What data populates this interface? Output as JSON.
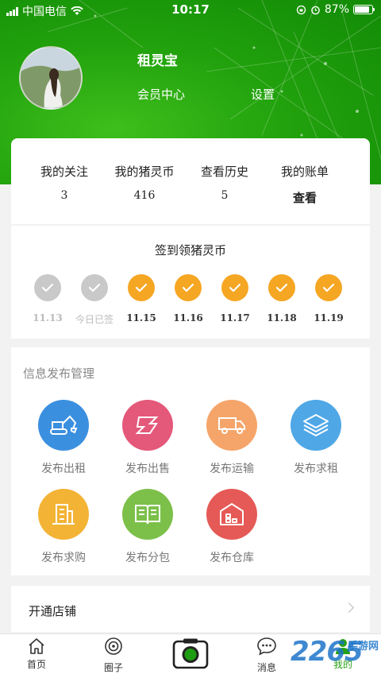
{
  "status_bar": {
    "carrier": "中国电信",
    "time": "10:17",
    "battery": "87%",
    "battery_level": 0.87
  },
  "profile": {
    "name": "租灵宝",
    "member_center": "会员中心",
    "settings": "设置"
  },
  "stats": [
    {
      "label": "我的关注",
      "value": "3"
    },
    {
      "label": "我的猪灵币",
      "value": "416"
    },
    {
      "label": "查看历史",
      "value": "5"
    },
    {
      "label": "我的账单",
      "value": "查看"
    }
  ],
  "checkin": {
    "title": "签到领猪灵币",
    "days": [
      {
        "label": "11.13",
        "state": "done"
      },
      {
        "label": "今日已签",
        "state": "today"
      },
      {
        "label": "11.15",
        "state": "future"
      },
      {
        "label": "11.16",
        "state": "future"
      },
      {
        "label": "11.17",
        "state": "future"
      },
      {
        "label": "11.18",
        "state": "future"
      },
      {
        "label": "11.19",
        "state": "future"
      }
    ]
  },
  "publish": {
    "title": "信息发布管理",
    "items": [
      {
        "label": "发布出租",
        "icon": "excavator-icon",
        "color": "#3b8fdf"
      },
      {
        "label": "发布出售",
        "icon": "steel-beam-icon",
        "color": "#e4587a"
      },
      {
        "label": "发布运输",
        "icon": "truck-icon",
        "color": "#f5a56a"
      },
      {
        "label": "发布求租",
        "icon": "layers-icon",
        "color": "#4fa7e6"
      },
      {
        "label": "发布求购",
        "icon": "building-icon",
        "color": "#f3b335"
      },
      {
        "label": "发布分包",
        "icon": "book-icon",
        "color": "#7cc04a"
      },
      {
        "label": "发布仓库",
        "icon": "warehouse-icon",
        "color": "#e55a56"
      }
    ]
  },
  "shop": {
    "label": "开通店铺"
  },
  "tabs": [
    {
      "label": "首页",
      "icon": "home-icon"
    },
    {
      "label": "圈子",
      "icon": "circle-icon"
    },
    {
      "label": "",
      "icon": "camera-icon"
    },
    {
      "label": "消息",
      "icon": "message-icon"
    },
    {
      "label": "我的",
      "icon": "user-icon",
      "active": true
    }
  ],
  "watermark": {
    "number": "2265",
    "tag": "手游网"
  },
  "colors": {
    "brand_green": "#28a116",
    "checkin_orange": "#f5a623",
    "checkin_done": "#c9c9c9"
  }
}
